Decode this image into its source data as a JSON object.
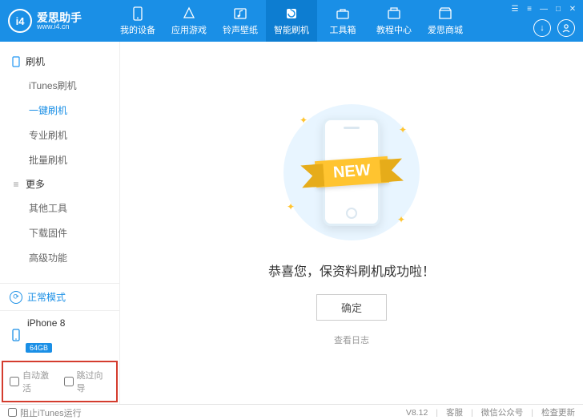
{
  "app": {
    "name": "爱思助手",
    "url": "www.i4.cn",
    "logo_letters": "i4"
  },
  "nav": [
    {
      "label": "我的设备",
      "icon": "phone"
    },
    {
      "label": "应用游戏",
      "icon": "apps"
    },
    {
      "label": "铃声壁纸",
      "icon": "music"
    },
    {
      "label": "智能刷机",
      "icon": "flash",
      "active": true
    },
    {
      "label": "工具箱",
      "icon": "toolbox"
    },
    {
      "label": "教程中心",
      "icon": "book"
    },
    {
      "label": "爱思商城",
      "icon": "shop"
    }
  ],
  "sidebar": {
    "groups": [
      {
        "title": "刷机",
        "items": [
          "iTunes刷机",
          "一键刷机",
          "专业刷机",
          "批量刷机"
        ],
        "active_index": 1
      },
      {
        "title": "更多",
        "items": [
          "其他工具",
          "下载固件",
          "高级功能"
        ]
      }
    ],
    "status_label": "正常模式",
    "device": {
      "name": "iPhone 8",
      "capacity": "64GB"
    },
    "checks": {
      "auto_activate": "自动激活",
      "skip_guide": "跳过向导"
    }
  },
  "main": {
    "ribbon": "NEW",
    "success": "恭喜您，保资料刷机成功啦！",
    "ok": "确定",
    "log": "查看日志"
  },
  "footer": {
    "block_itunes": "阻止iTunes运行",
    "version": "V8.12",
    "support": "客服",
    "wechat": "微信公众号",
    "update": "检查更新"
  }
}
